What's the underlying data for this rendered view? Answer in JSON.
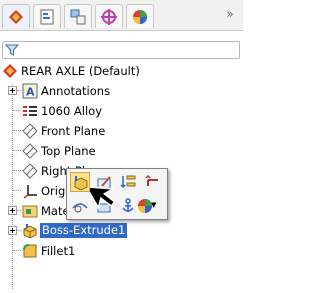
{
  "toolbar": {
    "tabs": [
      {
        "icon": "featuremanager-tab-icon",
        "active": true
      },
      {
        "icon": "propertymanager-tab-icon",
        "active": false
      },
      {
        "icon": "configurationmanager-tab-icon",
        "active": false
      },
      {
        "icon": "dimxpertmanager-tab-icon",
        "active": false
      },
      {
        "icon": "displaymanager-tab-icon",
        "active": false
      }
    ],
    "overflow_label": "»"
  },
  "filter": {
    "icon": "filter-funnel-icon",
    "value": ""
  },
  "tree": {
    "root": {
      "label": "REAR AXLE  (Default)",
      "icon": "part-icon"
    },
    "items": [
      {
        "label": "Annotations",
        "icon": "annotations-icon",
        "expandable": true
      },
      {
        "label": "1060 Alloy",
        "icon": "material-icon",
        "expandable": false
      },
      {
        "label": "Front Plane",
        "icon": "plane-icon",
        "expandable": false
      },
      {
        "label": "Top Plane",
        "icon": "plane-icon",
        "expandable": false
      },
      {
        "label": "Right Plane",
        "icon": "plane-icon",
        "expandable": false
      },
      {
        "label": "Origin",
        "icon": "origin-icon",
        "expandable": false
      },
      {
        "label": "MateReferences",
        "icon": "mate-references-icon",
        "expandable": true
      },
      {
        "label": "Boss-Extrude1",
        "icon": "boss-extrude-icon",
        "expandable": true,
        "selected": true
      },
      {
        "label": "Fillet1",
        "icon": "fillet-icon",
        "expandable": false
      }
    ]
  },
  "context_toolbar": {
    "buttons": [
      {
        "icon": "edit-feature-icon",
        "active": true
      },
      {
        "icon": "edit-sketch-icon",
        "active": false
      },
      {
        "icon": "rollback-icon",
        "active": false
      },
      {
        "icon": "return-icon",
        "active": false
      },
      {
        "icon": "hide-show-icon",
        "active": false
      },
      {
        "icon": "normal-to-icon",
        "active": false
      },
      {
        "icon": "anchor-icon",
        "active": false
      },
      {
        "icon": "appearance-icon",
        "active": false
      }
    ],
    "dropdown_glyph": "▼"
  },
  "colors": {
    "selection": "#316ac5",
    "active_button": "#fbe28c"
  }
}
